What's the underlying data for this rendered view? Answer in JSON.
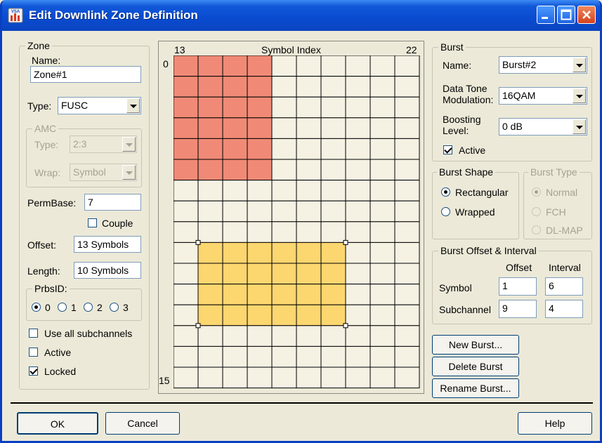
{
  "window": {
    "title": "Edit Downlink Zone Definition",
    "app_icon_label": "VSA",
    "controls": [
      "minimize",
      "maximize",
      "close"
    ]
  },
  "zone": {
    "legend": "Zone",
    "name_label": "Name:",
    "name_value": "Zone#1",
    "type_label": "Type:",
    "type_value": "FUSC",
    "amc": {
      "legend": "AMC",
      "type_label": "Type:",
      "type_value": "2:3",
      "wrap_label": "Wrap:",
      "wrap_value": "Symbol"
    },
    "permbase_label": "PermBase:",
    "permbase_value": "7",
    "couple_label": "Couple",
    "couple_checked": false,
    "offset_label": "Offset:",
    "offset_value": "13 Symbols",
    "length_label": "Length:",
    "length_value": "10 Symbols",
    "prbsid": {
      "legend": "PrbsID:",
      "options": [
        "0",
        "1",
        "2",
        "3"
      ],
      "selected": "0"
    },
    "use_all_label": "Use all subchannels",
    "use_all_checked": false,
    "active_label": "Active",
    "active_checked": false,
    "locked_label": "Locked",
    "locked_checked": true
  },
  "grid": {
    "header_start": "13",
    "header_title": "Symbol Index",
    "header_end": "22",
    "row_start": "0",
    "row_end": "15",
    "columns": 10,
    "rows": 16,
    "colors": {
      "burst1": "#f08a76",
      "burst2": "#fcd66f",
      "cell": "#f5f1e3",
      "line": "#000000"
    },
    "bursts": [
      {
        "name": "burst1",
        "col_start": 0,
        "col_span": 4,
        "row_start": 0,
        "row_span": 6
      },
      {
        "name": "burst2",
        "col_start": 1,
        "col_span": 6,
        "row_start": 9,
        "row_span": 4
      }
    ]
  },
  "burst": {
    "legend": "Burst",
    "name_label": "Name:",
    "name_value": "Burst#2",
    "modulation_label_1": "Data Tone",
    "modulation_label_2": "Modulation:",
    "modulation_value": "16QAM",
    "boosting_label_1": "Boosting",
    "boosting_label_2": "Level:",
    "boosting_value": "0 dB",
    "active_label": "Active",
    "active_checked": true
  },
  "burst_shape": {
    "legend": "Burst Shape",
    "rectangular_label": "Rectangular",
    "wrapped_label": "Wrapped",
    "selected": "Rectangular"
  },
  "burst_type": {
    "legend": "Burst Type",
    "normal_label": "Normal",
    "fch_label": "FCH",
    "dlmap_label": "DL-MAP",
    "selected": "Normal"
  },
  "burst_offset": {
    "legend": "Burst Offset & Interval",
    "offset_header": "Offset",
    "interval_header": "Interval",
    "symbol_label": "Symbol",
    "symbol_offset": "1",
    "symbol_interval": "6",
    "subchannel_label": "Subchannel",
    "subchannel_offset": "9",
    "subchannel_interval": "4"
  },
  "buttons": {
    "new_burst": "New Burst...",
    "delete_burst": "Delete Burst",
    "rename_burst": "Rename Burst...",
    "ok": "OK",
    "cancel": "Cancel",
    "help": "Help"
  }
}
